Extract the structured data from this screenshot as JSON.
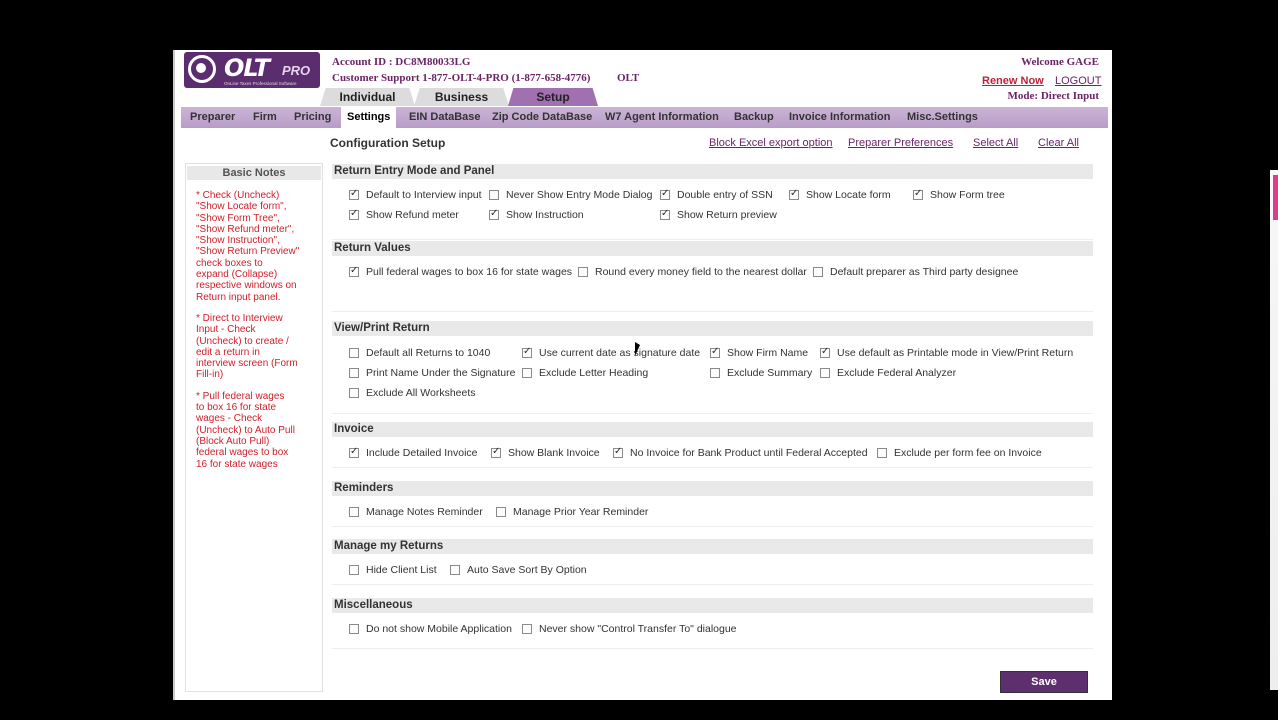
{
  "header": {
    "logo_text": "OLT",
    "logo_pro": "PRO",
    "logo_tag": "OnLine Taxes Professional Software",
    "account": "Account ID : DC8M80033LG",
    "support": "Customer Support 1-877-OLT-4-PRO (1-877-658-4776)",
    "brand": "OLT",
    "welcome": "Welcome GAGE",
    "renew": "Renew Now",
    "logout": "LOGOUT",
    "mode": "Mode: Direct Input"
  },
  "main_tabs": [
    "Individual",
    "Business",
    "Setup"
  ],
  "sub_tabs": [
    "Preparer",
    "Firm",
    "Pricing",
    "Settings",
    "EIN DataBase",
    "Zip Code DataBase",
    "W7 Agent Information",
    "Backup",
    "Invoice Information",
    "Misc.Settings"
  ],
  "sidebar": {
    "title": "Basic Notes",
    "notes": [
      "* Check (Uncheck)\n\"Show Locate form\",\n\"Show Form Tree\",\n\"Show Refund meter\",\n\"Show Instruction\",\n\"Show Return Preview\"\ncheck boxes  to\nexpand (Collapse)\nrespective windows on\nReturn input panel.",
      "* Direct to Interview\nInput - Check\n(Uncheck) to create /\nedit a return in\ninterview screen (Form\nFill-in)",
      "* Pull federal wages\nto box 16 for state\nwages - Check\n(Uncheck) to Auto Pull\n(Block Auto Pull)\nfederal wages to box\n16 for state wages"
    ]
  },
  "content": {
    "title": "Configuration Setup",
    "links": [
      "Block Excel export option",
      "Preparer Preferences",
      "Select All",
      "Clear All"
    ],
    "save_label": "Save"
  },
  "sections": [
    {
      "title": "Return Entry Mode and Panel",
      "options": [
        {
          "label": "Default to Interview input",
          "checked": true
        },
        {
          "label": "Never Show Entry Mode Dialog",
          "checked": false
        },
        {
          "label": "Double entry of SSN",
          "checked": true
        },
        {
          "label": "Show Locate form",
          "checked": true
        },
        {
          "label": "Show Form tree",
          "checked": true
        },
        {
          "label": "Show Refund meter",
          "checked": true
        },
        {
          "label": "Show Instruction",
          "checked": true
        },
        {
          "label": "Show Return preview",
          "checked": true
        }
      ]
    },
    {
      "title": "Return Values",
      "options": [
        {
          "label": "Pull federal wages to box 16 for state wages",
          "checked": true
        },
        {
          "label": "Round every money field to the nearest dollar",
          "checked": false
        },
        {
          "label": "Default preparer as Third party designee",
          "checked": false
        }
      ]
    },
    {
      "title": "View/Print Return",
      "options": [
        {
          "label": "Default all Returns to 1040",
          "checked": false
        },
        {
          "label": "Use current date as signature date",
          "checked": true
        },
        {
          "label": "Show Firm Name",
          "checked": true
        },
        {
          "label": "Use default as Printable mode in View/Print Return",
          "checked": true
        },
        {
          "label": "Print Name Under the Signature",
          "checked": false
        },
        {
          "label": "Exclude Letter Heading",
          "checked": false
        },
        {
          "label": "Exclude Summary",
          "checked": false
        },
        {
          "label": "Exclude Federal Analyzer",
          "checked": false
        },
        {
          "label": "Exclude All Worksheets",
          "checked": false
        }
      ]
    },
    {
      "title": "Invoice",
      "options": [
        {
          "label": "Include Detailed Invoice",
          "checked": true
        },
        {
          "label": "Show Blank Invoice",
          "checked": true
        },
        {
          "label": "No Invoice for Bank Product until Federal Accepted",
          "checked": true
        },
        {
          "label": "Exclude per form fee on Invoice",
          "checked": false
        }
      ]
    },
    {
      "title": "Reminders",
      "options": [
        {
          "label": "Manage Notes Reminder",
          "checked": false
        },
        {
          "label": "Manage Prior Year Reminder",
          "checked": false
        }
      ]
    },
    {
      "title": "Manage my Returns",
      "options": [
        {
          "label": "Hide Client List",
          "checked": false
        },
        {
          "label": "Auto Save Sort By Option",
          "checked": false
        }
      ]
    },
    {
      "title": "Miscellaneous",
      "options": [
        {
          "label": "Do not show Mobile Application",
          "checked": false
        },
        {
          "label": "Never show \"Control Transfer To\" dialogue",
          "checked": false
        }
      ]
    }
  ]
}
